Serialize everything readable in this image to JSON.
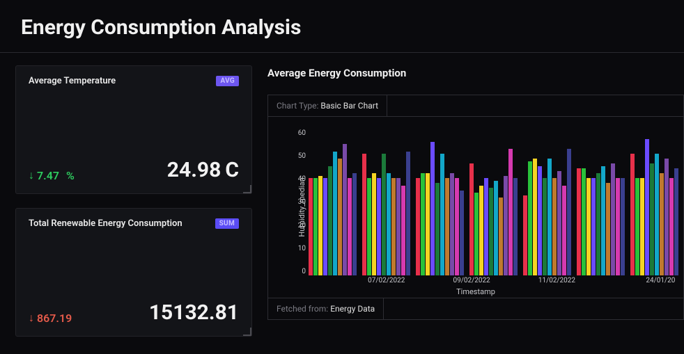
{
  "page_title": "Energy Consumption Analysis",
  "cards": {
    "temperature": {
      "title": "Average Temperature",
      "badge": "AVG",
      "delta_value": "7.47",
      "delta_unit": "%",
      "value": "24.98",
      "unit": "C"
    },
    "renewable": {
      "title": "Total Renewable Energy Consumption",
      "badge": "SUM",
      "delta_value": "867.19",
      "value": "15132.81"
    }
  },
  "chart": {
    "title": "Average Energy Consumption",
    "type_label": "Chart Type:",
    "type_value": "Basic Bar Chart",
    "y_label": "Humidity_median",
    "x_label": "Timestamp",
    "fetched_label": "Fetched from:",
    "fetched_value": "Energy Data",
    "y_ticks": [
      "0",
      "10",
      "20",
      "30",
      "40",
      "50",
      "60"
    ],
    "x_ticks": [
      {
        "label": "07/02/2022",
        "pos": 21
      },
      {
        "label": "09/02/2022",
        "pos": 44
      },
      {
        "label": "11/02/2022",
        "pos": 67
      },
      {
        "label": "24/01/20",
        "pos": 95
      }
    ]
  },
  "chart_data": {
    "type": "bar",
    "ylabel": "Humidity_median",
    "xlabel": "Timestamp",
    "ylim": [
      0,
      60
    ],
    "x_tick_labels": [
      "07/02/2022",
      "09/02/2022",
      "11/02/2022",
      "24/01/20"
    ],
    "series_colors": [
      "#e7304a",
      "#29c23a",
      "#f5d423",
      "#6b4bff",
      "#1b7a3a",
      "#13a7c9",
      "#c07a2e",
      "#7a4aa8",
      "#d63ab0",
      "#3a3f8f"
    ],
    "groups": [
      [
        40,
        40,
        41,
        40,
        45,
        51,
        48,
        54,
        40,
        42
      ],
      [
        50,
        40,
        42,
        40,
        50,
        42,
        40,
        40,
        37,
        51
      ],
      [
        40,
        42,
        42,
        55,
        38,
        50,
        40,
        42,
        40,
        35
      ],
      [
        46,
        34,
        37,
        40,
        36,
        39,
        32,
        41,
        52,
        40
      ],
      [
        33,
        47,
        48,
        45,
        40,
        48,
        40,
        43,
        37,
        52
      ],
      [
        44,
        44,
        40,
        40,
        42,
        45,
        38,
        46,
        40,
        40
      ],
      [
        50,
        40,
        40,
        56,
        46,
        50,
        42,
        48,
        40,
        44
      ]
    ]
  }
}
